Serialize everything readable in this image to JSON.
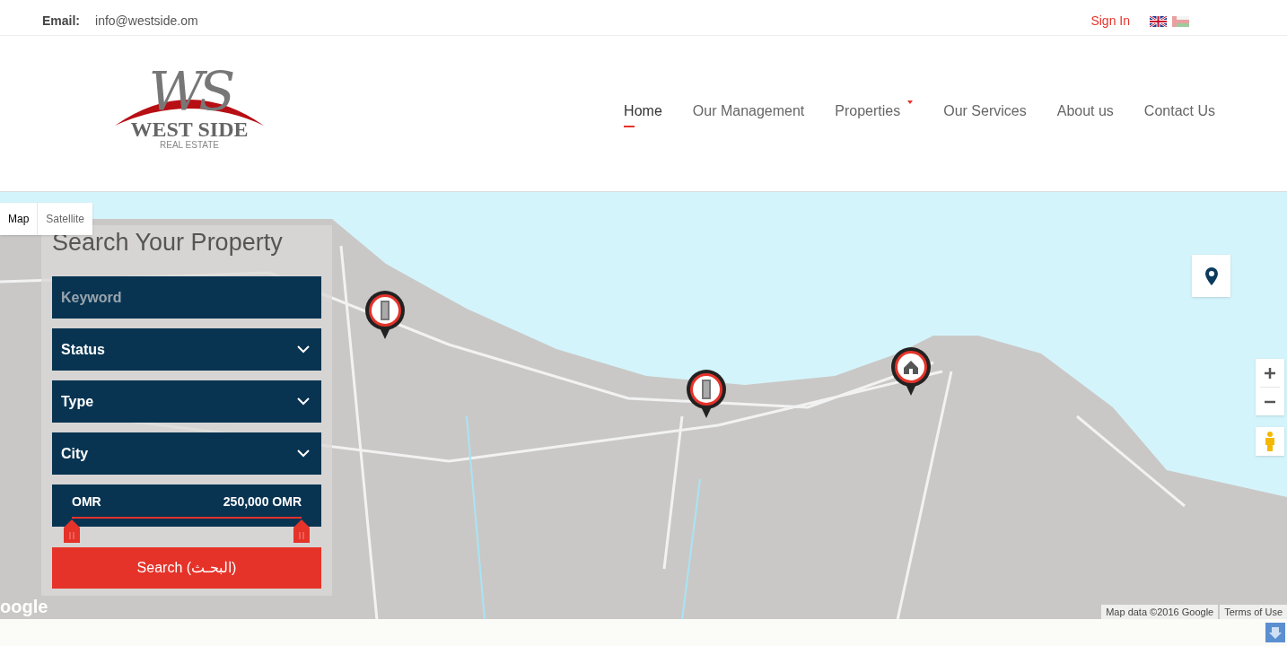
{
  "top_bar": {
    "email_label": "Email:",
    "email": "info@westside.om",
    "sign_in": "Sign In"
  },
  "logo": {
    "monogram": "WS",
    "name": "WEST SIDE",
    "tagline": "REAL ESTATE"
  },
  "nav": [
    {
      "label": "Home",
      "selected": true,
      "dropdown": false
    },
    {
      "label": "Our Management",
      "selected": false,
      "dropdown": false
    },
    {
      "label": "Properties",
      "selected": false,
      "dropdown": true
    },
    {
      "label": "Our Services",
      "selected": false,
      "dropdown": false
    },
    {
      "label": "About us",
      "selected": false,
      "dropdown": false
    },
    {
      "label": "Contact Us",
      "selected": false,
      "dropdown": false
    }
  ],
  "map": {
    "type_tabs": [
      {
        "label": "Map",
        "selected": true
      },
      {
        "label": "Satellite",
        "selected": false
      }
    ],
    "markers": [
      {
        "kind": "building"
      },
      {
        "kind": "building"
      },
      {
        "kind": "house"
      }
    ],
    "logo_text": "oogle",
    "attribution": "Map data ©2016 Google",
    "terms": "Terms of Use"
  },
  "search": {
    "title": "Search Your Property",
    "keyword": {
      "placeholder": "Keyword"
    },
    "selects": [
      "Status",
      "Type",
      "City"
    ],
    "price": {
      "min_label": "OMR",
      "max_label": "250,000 OMR",
      "thumbs": [
        {
          "level": 0
        },
        {
          "level": 1
        }
      ]
    },
    "button": "Search (البحـث)"
  }
}
